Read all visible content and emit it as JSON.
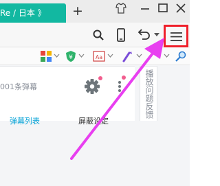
{
  "tab": {
    "title": "Re / 日本 》"
  },
  "new_tab": {
    "label": "+"
  },
  "panel": {
    "danmaku_count": "001条弹幕",
    "tabs": [
      "弹幕列表",
      "屏蔽设定"
    ],
    "side_label": "播放问题反馈"
  },
  "colors": {
    "tab_bg": "#12b8a1",
    "highlight_box": "#ef1f2a",
    "annotation_arrow": "#e83ff0",
    "accent_link": "#00a1d6"
  },
  "icons": {
    "title_bar": [
      "skin-icon",
      "minimize-icon",
      "maximize-icon",
      "close-icon"
    ],
    "toolbar": [
      "search-icon",
      "mobile-icon",
      "undo-icon",
      "menu-icon"
    ],
    "extensions": [
      "app-grid-icon",
      "shield-icon",
      "translate-icon",
      "grab-icon",
      "magnifier-icon"
    ]
  }
}
